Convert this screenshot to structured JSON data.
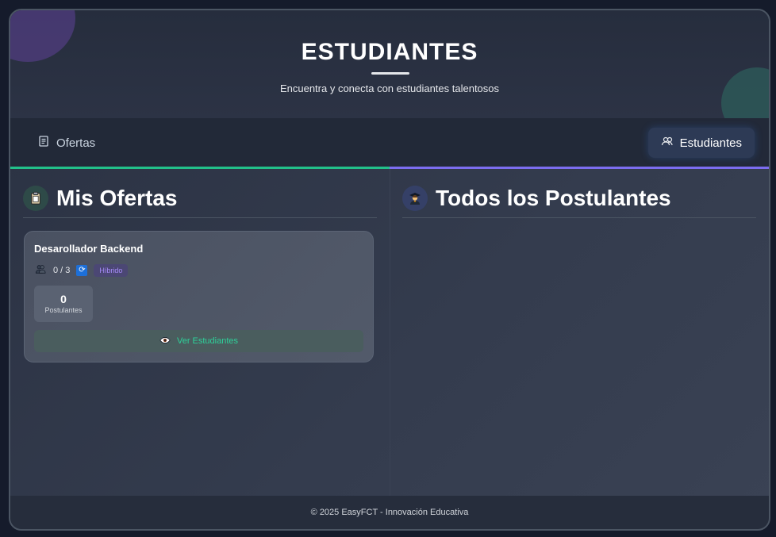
{
  "header": {
    "title": "ESTUDIANTES",
    "subtitle": "Encuentra y conecta con estudiantes talentosos"
  },
  "tabs": [
    {
      "label": "Ofertas",
      "icon": "scroll-icon",
      "active": false
    },
    {
      "label": "Estudiantes",
      "icon": "users-icon",
      "active": true
    }
  ],
  "left_panel": {
    "icon": "clipboard-icon",
    "heading": "Mis Ofertas",
    "offers": [
      {
        "title": "Desarollador Backend",
        "positions": "0 / 3",
        "mode": "Híbrido",
        "applicants_count": "0",
        "applicants_label": "Postulantes",
        "view_label": "Ver Estudiantes"
      }
    ]
  },
  "right_panel": {
    "icon": "graduate-icon",
    "heading": "Todos los Postulantes"
  },
  "footer": {
    "text": "© 2025 EasyFCT - Innovación Educativa"
  },
  "colors": {
    "accent_green": "#22c08a",
    "accent_purple": "#7c6df0",
    "badge_purple": "#a78bfa",
    "button_green_text": "#2ed19a"
  }
}
